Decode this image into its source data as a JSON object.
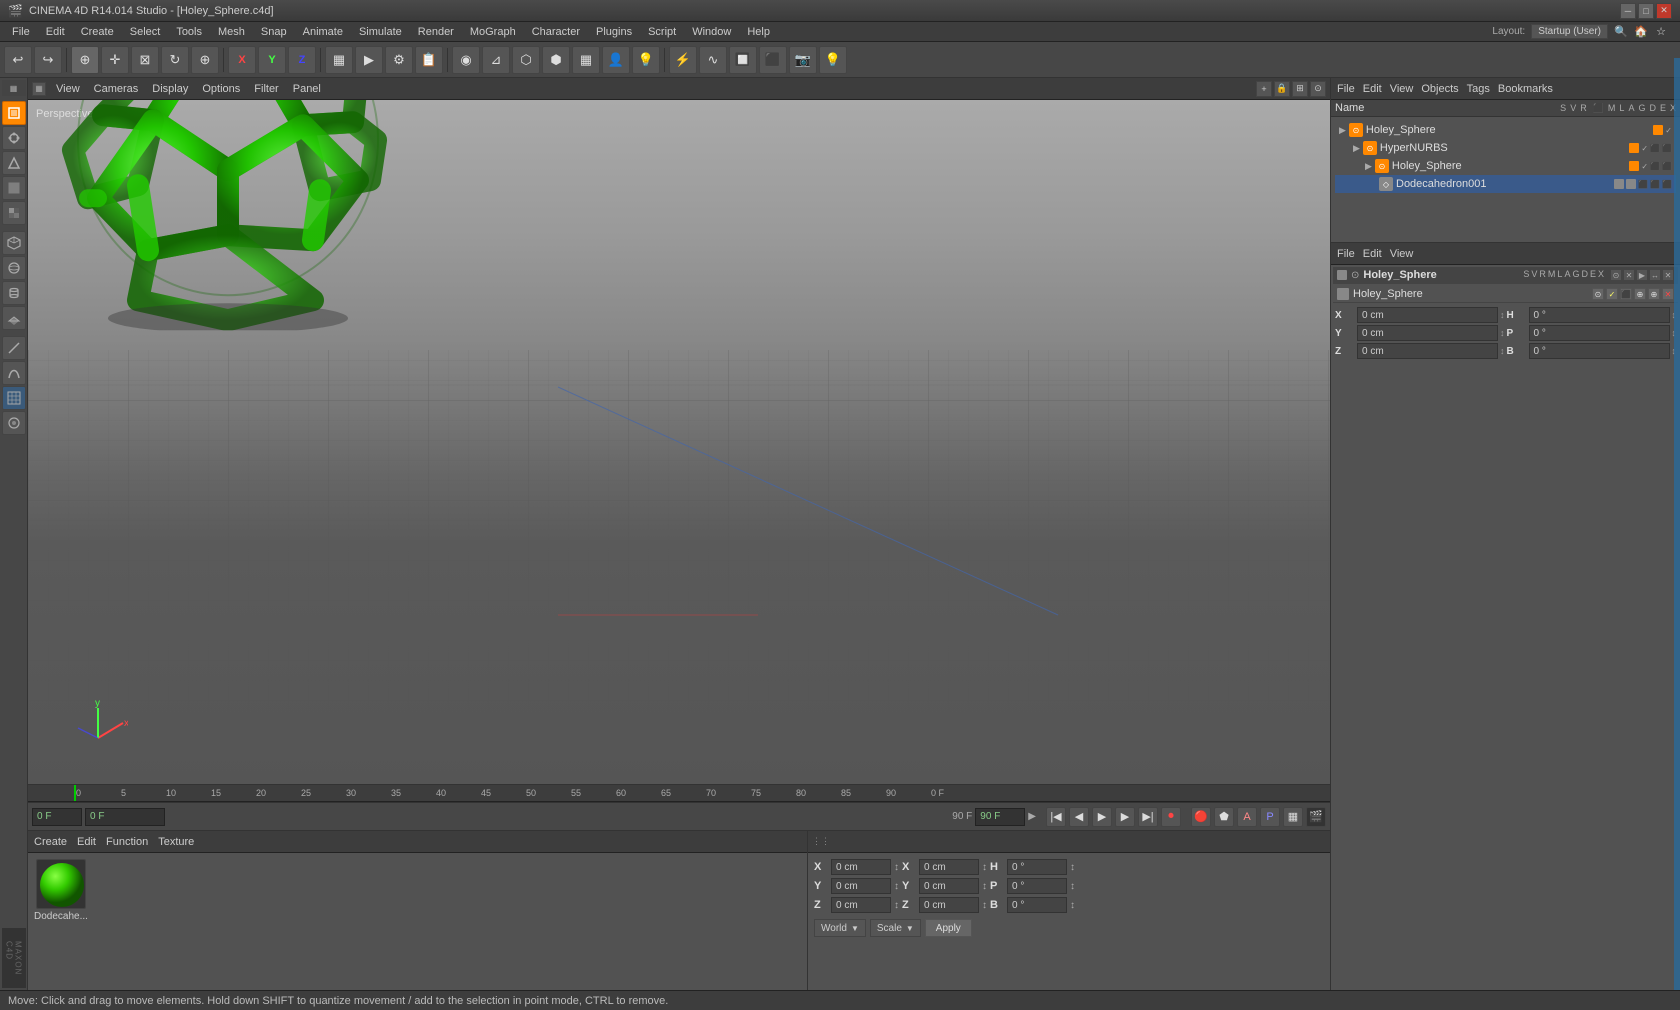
{
  "window": {
    "title": "CINEMA 4D R14.014 Studio - [Holey_Sphere.c4d]",
    "close_btn": "✕",
    "min_btn": "─",
    "max_btn": "□"
  },
  "menubar": {
    "items": [
      "File",
      "Edit",
      "Create",
      "Select",
      "Tools",
      "Mesh",
      "Snap",
      "Animate",
      "Simulate",
      "Render",
      "MoGraph",
      "Character",
      "Plugins",
      "Script",
      "Window",
      "Help"
    ],
    "layout_label": "Layout:",
    "layout_value": "Startup (User)"
  },
  "viewport": {
    "menus": [
      "View",
      "Cameras",
      "Display",
      "Options",
      "Filter",
      "Panel"
    ],
    "perspective_label": "Perspective",
    "corner_icons": [
      "+",
      "×",
      "□",
      "⊙"
    ]
  },
  "timeline": {
    "frame_start": "0 F",
    "frame_field": "0 F",
    "frame_end": "90 F",
    "frame_end2": "90 F"
  },
  "object_manager": {
    "menus": [
      "File",
      "Edit",
      "View",
      "Objects",
      "Tags",
      "Bookmarks"
    ],
    "title": "Holey_Sphere",
    "items": [
      {
        "name": "Holey_Sphere",
        "icon": "🎯",
        "indent": 0,
        "color": "orange"
      },
      {
        "name": "HyperNURBS",
        "icon": "⊙",
        "indent": 1,
        "color": "orange"
      },
      {
        "name": "Holey_Sphere",
        "icon": "🎯",
        "indent": 2,
        "color": "orange"
      },
      {
        "name": "Dodecahedron001",
        "icon": "◇",
        "indent": 3,
        "color": "gray"
      }
    ]
  },
  "attributes": {
    "menus": [
      "File",
      "Edit",
      "View"
    ],
    "object_name": "Holey_Sphere",
    "cols": [
      "Name",
      "S",
      "V",
      "R",
      "M",
      "L",
      "A",
      "G",
      "D",
      "E",
      "X"
    ],
    "coords": {
      "x_pos": "0 cm",
      "x_size": "0 cm",
      "x_rot": "0°",
      "y_pos": "0 cm",
      "y_size": "0 cm",
      "y_rot": "0°",
      "z_pos": "0 cm",
      "z_size": "0 cm",
      "z_rot": "0°"
    }
  },
  "materials": {
    "menus": [
      "Create",
      "Edit",
      "Function",
      "Texture"
    ],
    "items": [
      {
        "name": "Dodecahe..."
      }
    ]
  },
  "coordinates": {
    "world_label": "World",
    "scale_label": "Scale",
    "apply_label": "Apply",
    "rows": [
      {
        "axis": "X",
        "pos": "0 cm",
        "pos_unit": "↕",
        "label2": "X",
        "size": "0 cm",
        "size_unit": "↕",
        "label3": "H",
        "rot": "0°"
      },
      {
        "axis": "Y",
        "pos": "0 cm",
        "pos_unit": "↕",
        "label2": "Y",
        "size": "0 cm",
        "size_unit": "↕",
        "label3": "P",
        "rot": "0°"
      },
      {
        "axis": "Z",
        "pos": "0 cm",
        "pos_unit": "↕",
        "label2": "Z",
        "size": "0 cm",
        "size_unit": "↕",
        "label3": "B",
        "rot": "0°"
      }
    ]
  },
  "statusbar": {
    "text": "Move: Click and drag to move elements. Hold down SHIFT to quantize movement / add to the selection in point mode, CTRL to remove."
  }
}
